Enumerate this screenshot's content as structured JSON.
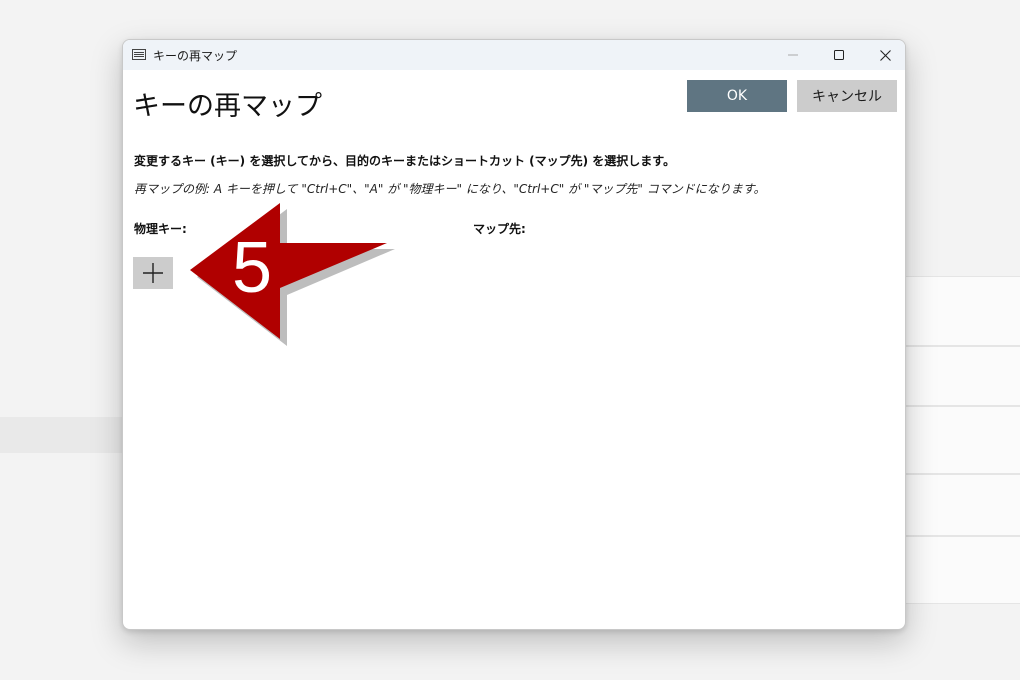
{
  "window": {
    "title": "キーの再マップ",
    "controls": {
      "minimize": "minimize",
      "maximize": "maximize",
      "close": "close"
    }
  },
  "dialog": {
    "heading": "キーの再マップ",
    "ok_label": "OK",
    "cancel_label": "キャンセル",
    "instruction": "変更するキー (キー) を選択してから、目的のキーまたはショートカット (マップ先) を選択します。",
    "example": "再マップの例: A キーを押して \"Ctrl+C\"、\"A\" が \"物理キー\" になり、\"Ctrl+C\" が \"マップ先\" コマンドになります。",
    "physical_key_label": "物理キー:",
    "mapped_to_label": "マップ先:",
    "add_icon": "plus-icon"
  },
  "annotation": {
    "step_number": "5",
    "arrow_color": "#b00000"
  }
}
